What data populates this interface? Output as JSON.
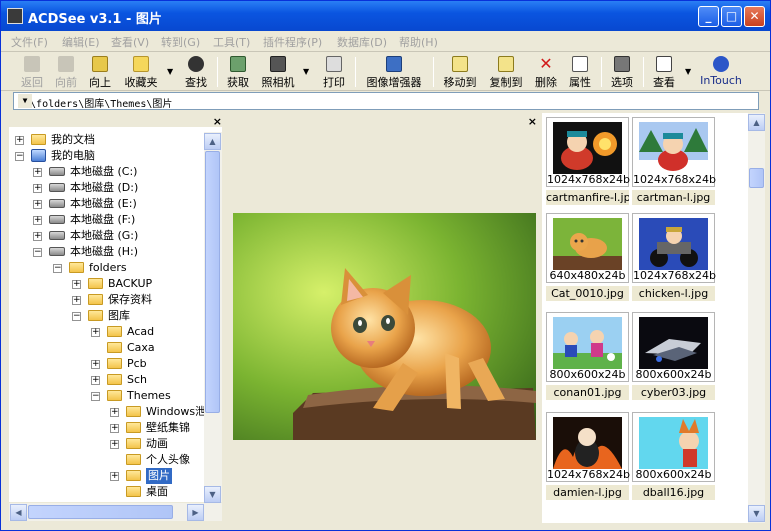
{
  "window": {
    "title": "ACDSee v3.1 - 图片",
    "min": "_",
    "max": "□",
    "close": "✕"
  },
  "menu": [
    "文件(F)",
    "编辑(E)",
    "查看(V)",
    "转到(G)",
    "工具(T)",
    "插件程序(P)",
    "数据库(D)",
    "帮助(H)"
  ],
  "toolbar": {
    "back": "返回",
    "forward": "向前",
    "up": "向上",
    "favorites": "收藏夹",
    "find": "查找",
    "acquire": "获取",
    "camera": "照相机",
    "print": "打印",
    "enhance": "图像增强器",
    "move": "移动到",
    "copy": "复制到",
    "delete": "删除",
    "properties": "属性",
    "options": "选项",
    "view": "查看",
    "intouch": "InTouch"
  },
  "address": {
    "path": "H:\\folders\\图库\\Themes\\图片"
  },
  "tree": {
    "close": "×",
    "items": [
      {
        "label": "我的文档"
      },
      {
        "label": "我的电脑"
      },
      {
        "label": "本地磁盘 (C:)"
      },
      {
        "label": "本地磁盘 (D:)"
      },
      {
        "label": "本地磁盘 (E:)"
      },
      {
        "label": "本地磁盘 (F:)"
      },
      {
        "label": "本地磁盘 (G:)"
      },
      {
        "label": "本地磁盘 (H:)"
      },
      {
        "label": "folders"
      },
      {
        "label": "BACKUP"
      },
      {
        "label": "保存资料"
      },
      {
        "label": "图库"
      },
      {
        "label": "Acad"
      },
      {
        "label": "Caxa"
      },
      {
        "label": "Pcb"
      },
      {
        "label": "Sch"
      },
      {
        "label": "Themes"
      },
      {
        "label": "Windows泄"
      },
      {
        "label": "壁纸集锦"
      },
      {
        "label": "动画"
      },
      {
        "label": "个人头像"
      },
      {
        "label": "图片"
      },
      {
        "label": "桌面"
      }
    ]
  },
  "preview": {
    "close": "×"
  },
  "thumbnails": [
    {
      "dim": "1024x768x24b",
      "name": "cartmanfire-l.jpg"
    },
    {
      "dim": "1024x768x24b",
      "name": "cartman-l.jpg"
    },
    {
      "dim": "640x480x24b",
      "name": "Cat_0010.jpg"
    },
    {
      "dim": "1024x768x24b",
      "name": "chicken-l.jpg"
    },
    {
      "dim": "800x600x24b",
      "name": "conan01.jpg"
    },
    {
      "dim": "800x600x24b",
      "name": "cyber03.jpg"
    },
    {
      "dim": "1024x768x24b",
      "name": "damien-l.jpg"
    },
    {
      "dim": "800x600x24b",
      "name": "dball16.jpg"
    }
  ],
  "colors": {
    "titlebar": "#0A55E0",
    "selection": "#316AC5",
    "chrome": "#ECE9D8"
  }
}
